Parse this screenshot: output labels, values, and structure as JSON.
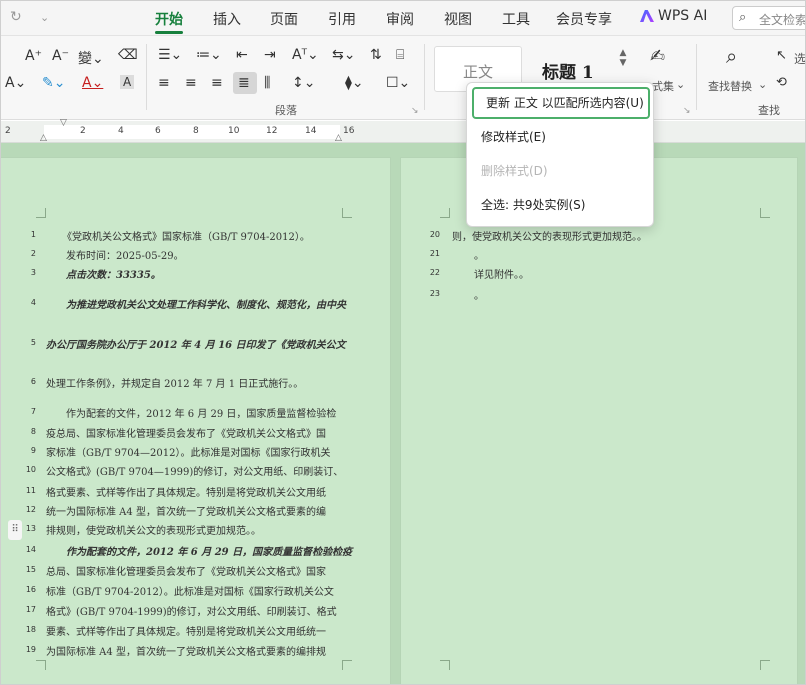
{
  "menubar": {
    "tabs": [
      "开始",
      "插入",
      "页面",
      "引用",
      "审阅",
      "视图",
      "工具",
      "会员专享"
    ],
    "active_tab": "开始",
    "wps_ai": "WPS AI",
    "search_placeholder": "全文检索"
  },
  "ribbon": {
    "paragraph_group": "段落",
    "find_group": "查找",
    "style_normal": "正文",
    "style_heading1": "标题 1",
    "style_set_label": "式集",
    "find_replace": "查找替换",
    "select_partial": "选"
  },
  "ruler": {
    "numbers": [
      "2",
      "2",
      "4",
      "6",
      "8",
      "10",
      "12",
      "14",
      "16"
    ]
  },
  "context_menu": {
    "items": [
      {
        "label": "更新 正文 以匹配所选内容(U)",
        "state": "highlighted"
      },
      {
        "label": "修改样式(E)",
        "state": "normal"
      },
      {
        "label": "删除样式(D)",
        "state": "disabled"
      },
      {
        "label": "全选: 共9处实例(S)",
        "state": "normal"
      }
    ]
  },
  "left_page": [
    {
      "n": "1",
      "text": "《党政机关公文格式》国家标准（GB/T 9704-2012）。",
      "style": "normal"
    },
    {
      "n": "2",
      "text": "发布时间：2025-05-29。",
      "style": "normal"
    },
    {
      "n": "3",
      "text": "点击次数：33335。",
      "style": "bold"
    },
    {
      "n": "4",
      "text": "为推进党政机关公文处理工作科学化、制度化、规范化，由中央",
      "style": "bold"
    },
    {
      "n": "5",
      "text": "办公厅国务院办公厅于 2012 年 4 月 16 日印发了《党政机关公文",
      "style": "bold"
    },
    {
      "n": "6",
      "text": "处理工作条例》，并规定自 2012 年 7 月 1 日正式施行。。",
      "style": "normal"
    },
    {
      "n": "7",
      "text": "作为配套的文件，2012 年 6 月 29 日，国家质量监督检验检",
      "style": "normal"
    },
    {
      "n": "8",
      "text": "疫总局、国家标准化管理委员会发布了《党政机关公文格式》国",
      "style": "normal"
    },
    {
      "n": "9",
      "text": "家标准（GB/T 9704—2012）。此标准是对国标《国家行政机关",
      "style": "normal"
    },
    {
      "n": "10",
      "text": "公文格式》(GB/T 9704—1999)的修订，对公文用纸、印刷装订、",
      "style": "normal"
    },
    {
      "n": "11",
      "text": "格式要素、式样等作出了具体规定。特别是将党政机关公文用纸",
      "style": "normal"
    },
    {
      "n": "12",
      "text": "统一为国际标准 A4 型，首次统一了党政机关公文格式要素的编",
      "style": "normal"
    },
    {
      "n": "13",
      "text": "排规则，使党政机关公文的表现形式更加规范。。",
      "style": "normal"
    },
    {
      "n": "14",
      "text": "作为配套的文件，2012 年 6 月 29 日，国家质量监督检验检疫",
      "style": "bold"
    },
    {
      "n": "15",
      "text": "总局、国家标准化管理委员会发布了《党政机关公文格式》国家",
      "style": "normal"
    },
    {
      "n": "16",
      "text": "标准（GB/T 9704-2012）。此标准是对国标《国家行政机关公文",
      "style": "normal"
    },
    {
      "n": "17",
      "text": "格式》(GB/T 9704-1999)的修订，对公文用纸、印刷装订、格式",
      "style": "normal"
    },
    {
      "n": "18",
      "text": "要素、式样等作出了具体规定。特别是将党政机关公文用纸统一",
      "style": "normal"
    },
    {
      "n": "19",
      "text": "为国际标准 A4 型，首次统一了党政机关公文格式要素的编排规",
      "style": "normal"
    }
  ],
  "right_page": [
    {
      "n": "20",
      "text": "则，使党政机关公文的表现形式更加规范。。"
    },
    {
      "n": "21",
      "text": "。"
    },
    {
      "n": "22",
      "text": "详见附件。。"
    },
    {
      "n": "23",
      "text": "。"
    }
  ]
}
